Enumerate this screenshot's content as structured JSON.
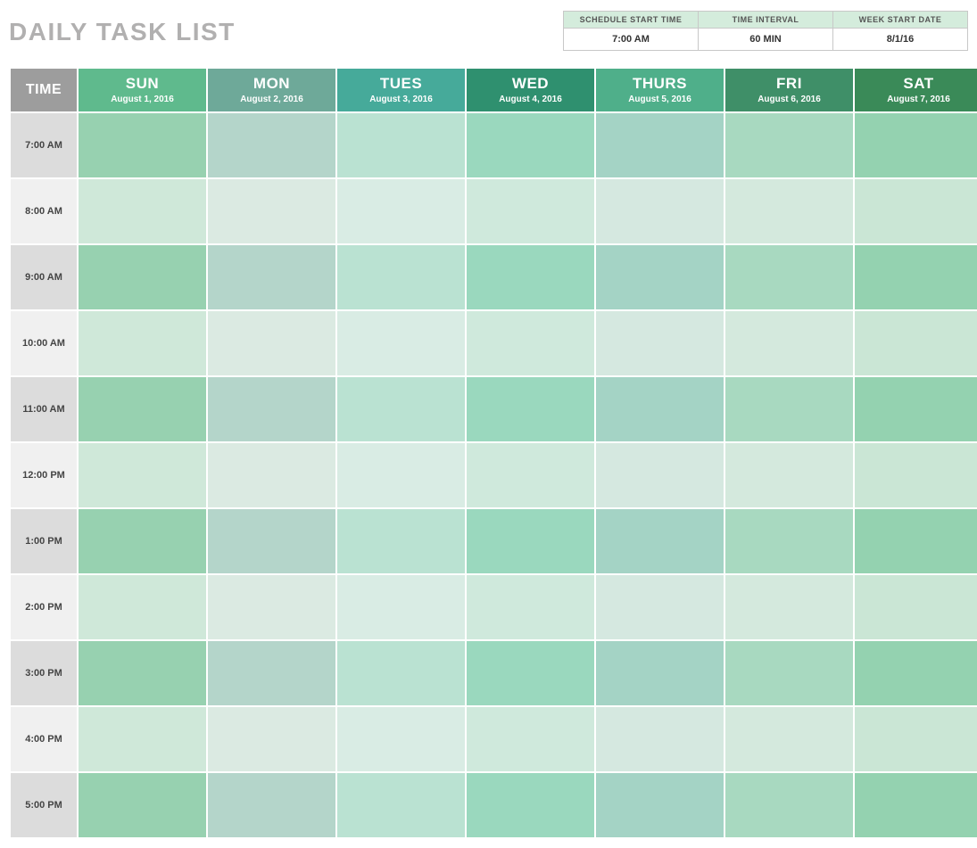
{
  "title": "DAILY TASK LIST",
  "meta": [
    {
      "label": "SCHEDULE START TIME",
      "value": "7:00 AM"
    },
    {
      "label": "TIME INTERVAL",
      "value": "60 MIN"
    },
    {
      "label": "WEEK START DATE",
      "value": "8/1/16"
    }
  ],
  "timeHeader": "TIME",
  "days": [
    {
      "name": "SUN",
      "date": "August 1, 2016"
    },
    {
      "name": "MON",
      "date": "August 2, 2016"
    },
    {
      "name": "TUES",
      "date": "August 3, 2016"
    },
    {
      "name": "WED",
      "date": "August 4, 2016"
    },
    {
      "name": "THURS",
      "date": "August 5, 2016"
    },
    {
      "name": "FRI",
      "date": "August 6, 2016"
    },
    {
      "name": "SAT",
      "date": "August 7, 2016"
    }
  ],
  "times": [
    "7:00 AM",
    "8:00 AM",
    "9:00 AM",
    "10:00 AM",
    "11:00 AM",
    "12:00 PM",
    "1:00 PM",
    "2:00 PM",
    "3:00 PM",
    "4:00 PM",
    "5:00 PM"
  ]
}
